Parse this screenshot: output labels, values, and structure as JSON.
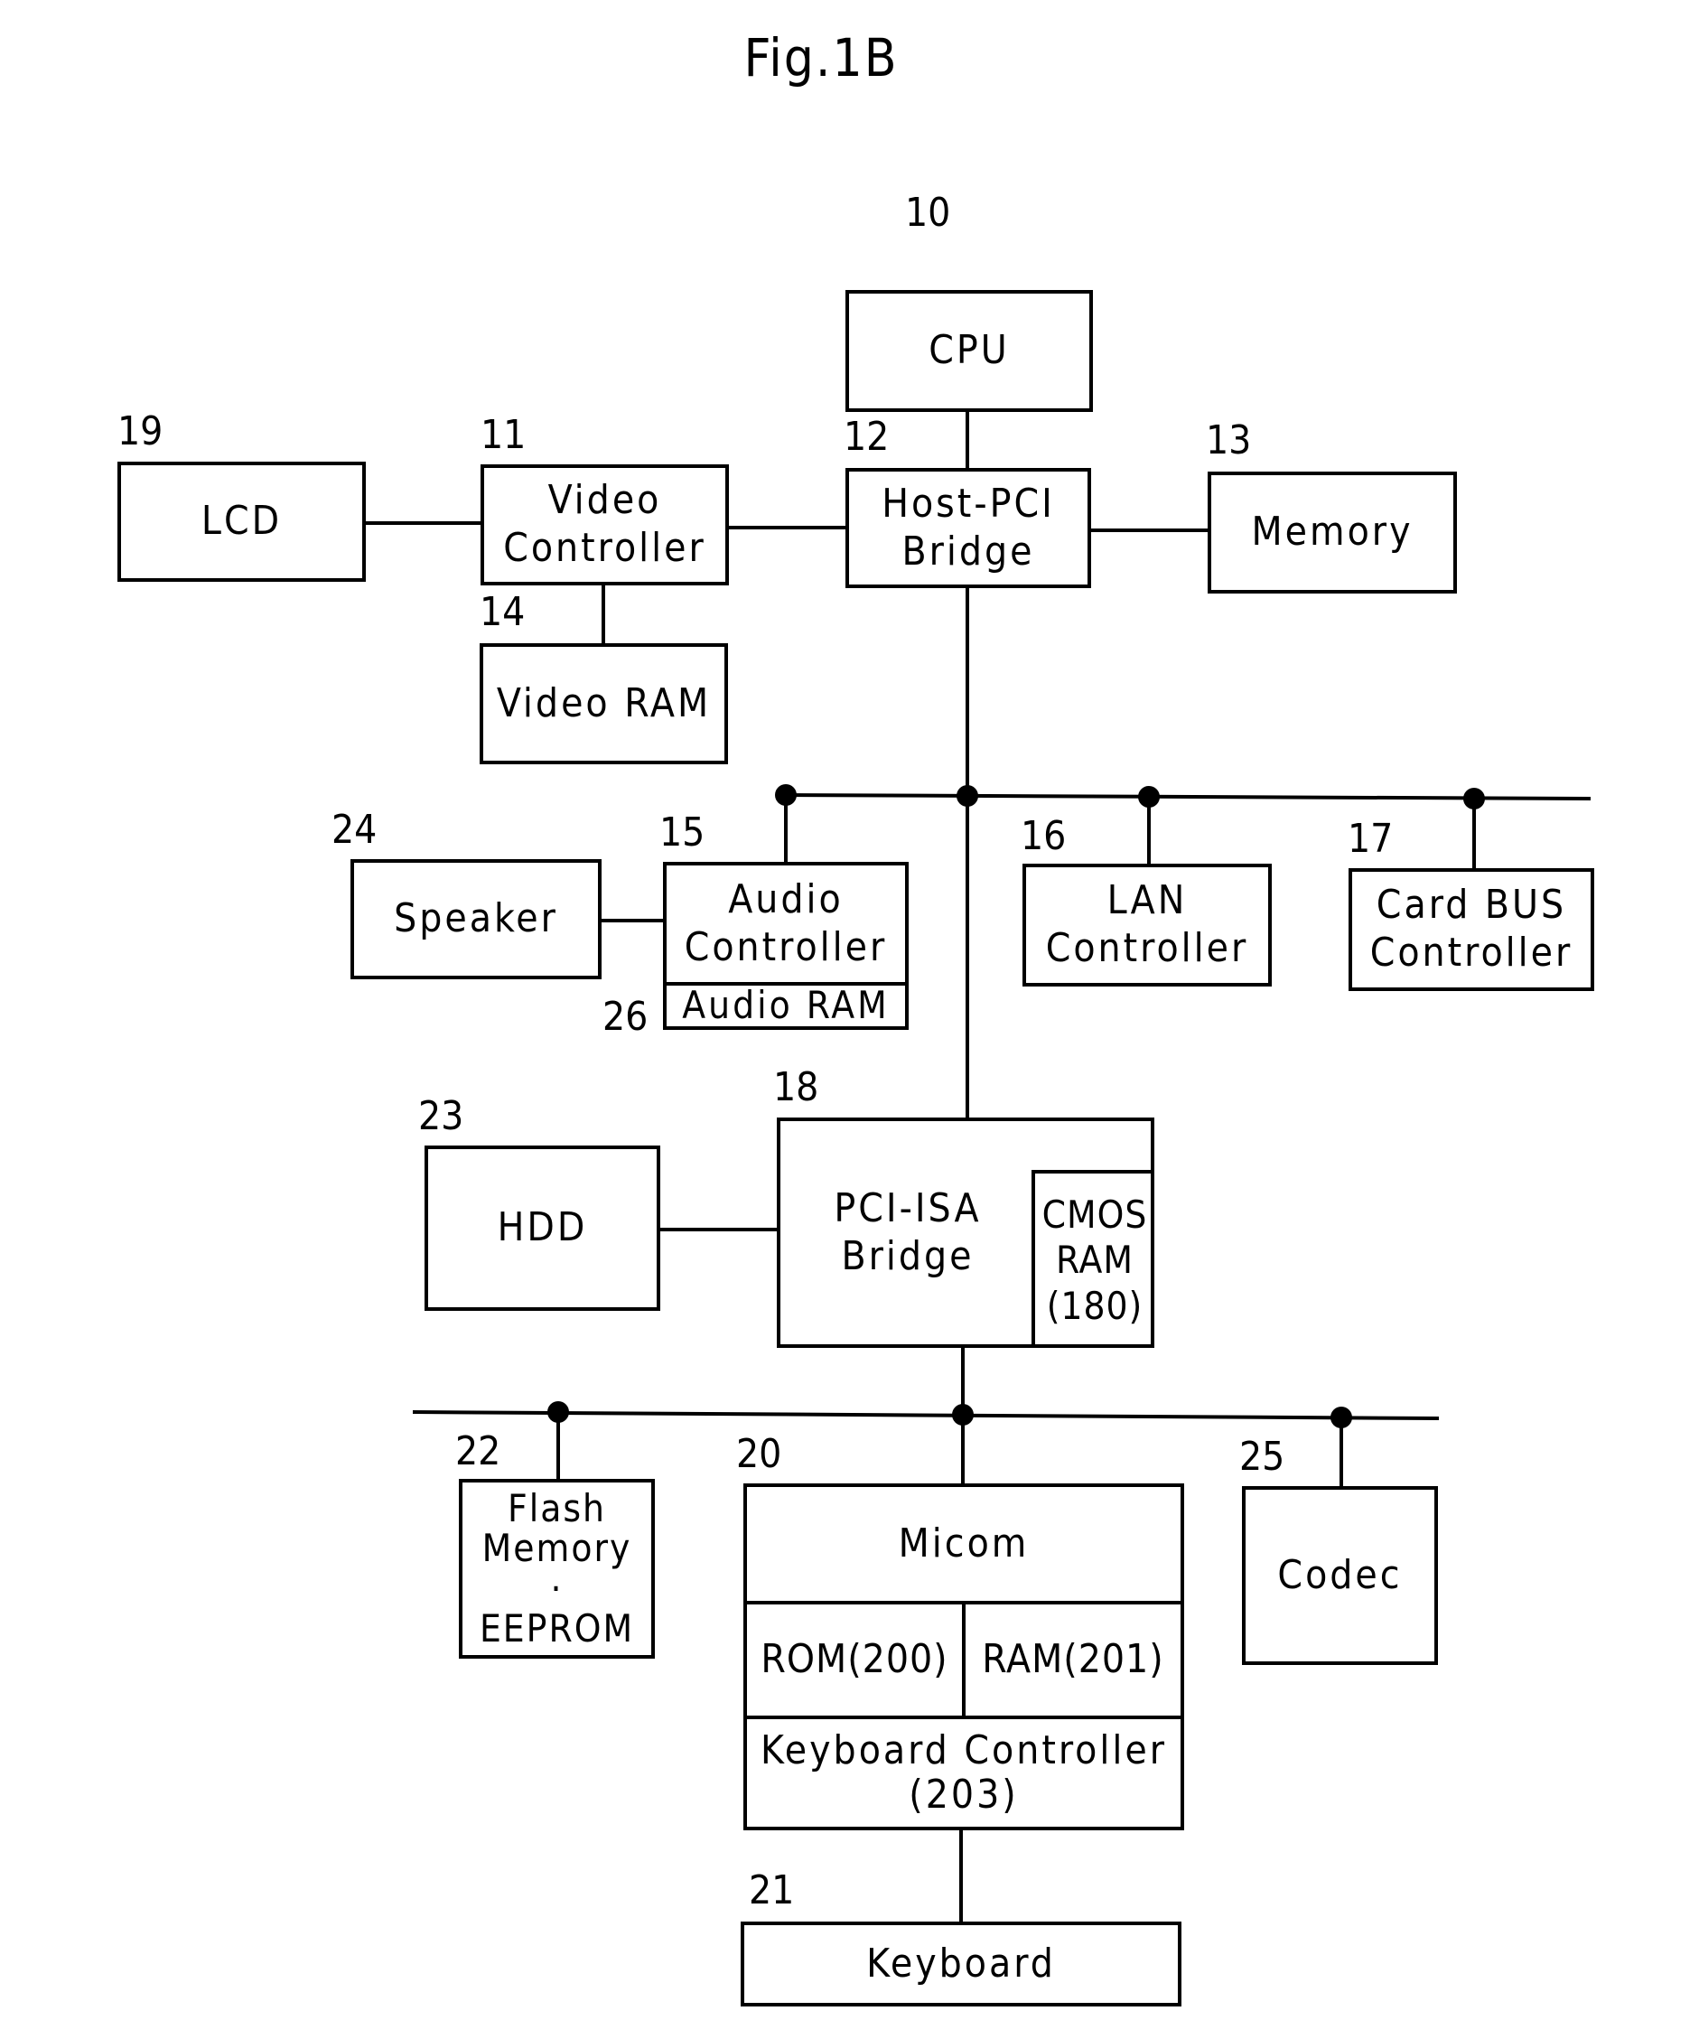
{
  "figure": {
    "title": "Fig.1B"
  },
  "blocks": {
    "cpu": {
      "ref": "10",
      "label": "CPU"
    },
    "video_controller": {
      "ref": "11",
      "label": "Video\nController"
    },
    "host_pci_bridge": {
      "ref": "12",
      "label": "Host-PCI\nBridge"
    },
    "memory": {
      "ref": "13",
      "label": "Memory"
    },
    "video_ram": {
      "ref": "14",
      "label": "Video RAM"
    },
    "audio_controller": {
      "ref": "15",
      "label": "Audio\nController"
    },
    "lan_controller": {
      "ref": "16",
      "label": "LAN\nController"
    },
    "card_bus_controller": {
      "ref": "17",
      "label": "Card BUS\nController"
    },
    "pci_isa_bridge": {
      "ref": "18",
      "label": "PCI-ISA\nBridge",
      "cmos_ram": "CMOS\nRAM\n(180)"
    },
    "lcd": {
      "ref": "19",
      "label": "LCD"
    },
    "micom": {
      "ref": "20",
      "label": "Micom",
      "rom": "ROM(200)",
      "ram": "RAM(201)",
      "keyboard_controller": "Keyboard Controller\n(203)"
    },
    "keyboard": {
      "ref": "21",
      "label": "Keyboard"
    },
    "flash_memory": {
      "ref": "22",
      "label": "Flash\nMemory\n·\nEEPROM"
    },
    "hdd": {
      "ref": "23",
      "label": "HDD"
    },
    "speaker": {
      "ref": "24",
      "label": "Speaker"
    },
    "codec": {
      "ref": "25",
      "label": "Codec"
    },
    "audio_ram": {
      "ref": "26",
      "label": "Audio RAM"
    }
  }
}
